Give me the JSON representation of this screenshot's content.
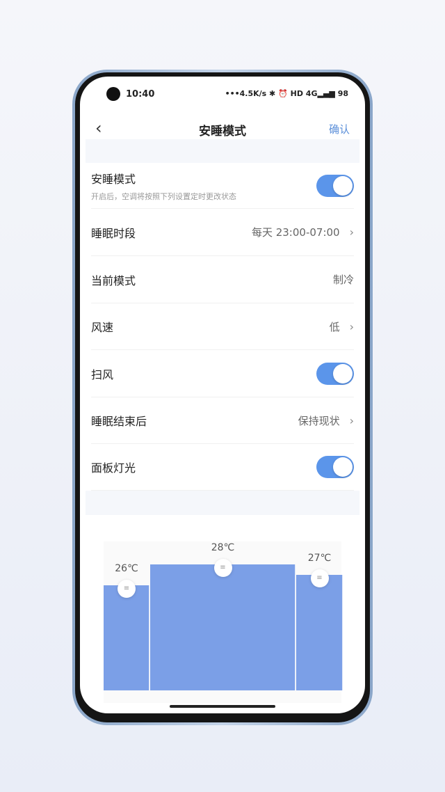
{
  "status": {
    "time": "10:40",
    "icons": "•••4.5K/s ✱ ⏰ HD 4G▂▄▆ 98"
  },
  "header": {
    "title": "安睡模式",
    "confirm": "确认",
    "back_icon": "chevron-left"
  },
  "rows": [
    {
      "label": "安睡模式",
      "sub": "开启后，空调将按照下列设置定时更改状态",
      "toggle": true
    },
    {
      "label": "睡眠时段",
      "value": "每天 23:00-07:00",
      "chevron": true
    },
    {
      "label": "当前模式",
      "value": "制冷"
    },
    {
      "label": "风速",
      "value": "低",
      "chevron": true
    },
    {
      "label": "扫风",
      "toggle": true
    },
    {
      "label": "睡眠结束后",
      "value": "保持现状",
      "chevron": true
    },
    {
      "label": "面板灯光",
      "toggle": true
    }
  ],
  "chart_data": {
    "type": "bar",
    "segments": [
      {
        "label": "26℃",
        "value": 26
      },
      {
        "label": "28℃",
        "value": 28
      },
      {
        "label": "27℃",
        "value": 27
      }
    ],
    "color": "#7b9fe7"
  },
  "accent": "#5b95ea"
}
